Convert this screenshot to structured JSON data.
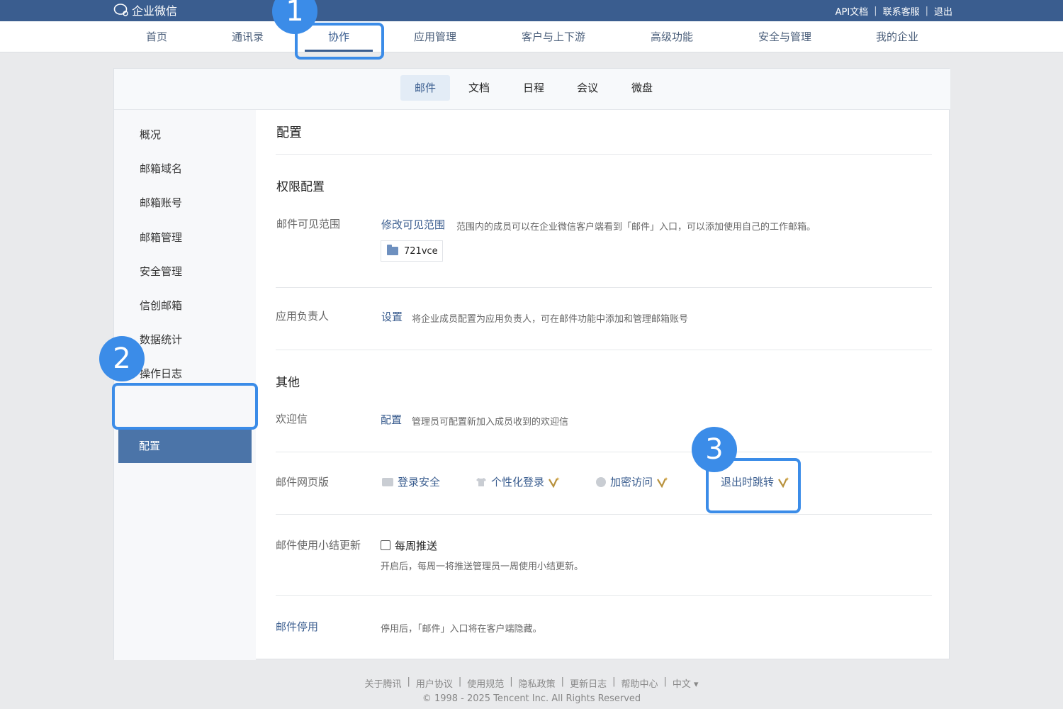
{
  "app": {
    "logo_text": "企业微信"
  },
  "top_links": [
    "API文档",
    "联系客服",
    "退出"
  ],
  "nav": {
    "items": [
      "首页",
      "通讯录",
      "协作",
      "应用管理",
      "客户与上下游",
      "高级功能",
      "安全与管理",
      "我的企业"
    ],
    "active": "协作"
  },
  "subtabs": {
    "items": [
      "邮件",
      "文档",
      "日程",
      "会议",
      "微盘"
    ],
    "active": "邮件"
  },
  "sidebar": {
    "items": [
      "概况",
      "邮箱域名",
      "邮箱账号",
      "邮箱管理",
      "安全管理",
      "信创邮箱",
      "数据统计",
      "操作日志",
      "配置"
    ],
    "active": "配置"
  },
  "main": {
    "title": "配置",
    "permission": {
      "heading": "权限配置",
      "visibility_label": "邮件可见范围",
      "visibility_link": "修改可见范围",
      "visibility_desc": "范围内的成员可以在企业微信客户端看到「邮件」入口，可以添加使用自己的工作邮箱。",
      "visibility_tag": "721vce",
      "owner_label": "应用负责人",
      "owner_link": "设置",
      "owner_desc": "将企业成员配置为应用负责人，可在邮件功能中添加和管理邮箱账号"
    },
    "other": {
      "heading": "其他",
      "welcome_label": "欢迎信",
      "welcome_link": "配置",
      "welcome_desc": "管理员可配置新加入成员收到的欢迎信",
      "web_label": "邮件网页版",
      "web_features": [
        "登录安全",
        "个性化登录",
        "加密访问",
        "退出时跳转"
      ],
      "summary_label": "邮件使用小结更新",
      "summary_checkbox": "每周推送",
      "summary_desc": "开启后，每周一将推送管理员一周使用小结更新。",
      "disable_link": "邮件停用",
      "disable_desc": "停用后，「邮件」入口将在客户端隐藏。"
    }
  },
  "callouts": [
    "1",
    "2",
    "3"
  ],
  "footer": {
    "links": [
      "关于腾讯",
      "用户协议",
      "使用规范",
      "隐私政策",
      "更新日志",
      "帮助中心",
      "中文 ▾"
    ],
    "copyright": "© 1998 - 2025 Tencent Inc. All Rights Reserved"
  },
  "colors": {
    "brand": "#3a5d8f",
    "callout": "#3b8ce8",
    "active_side": "#4b74a8"
  }
}
